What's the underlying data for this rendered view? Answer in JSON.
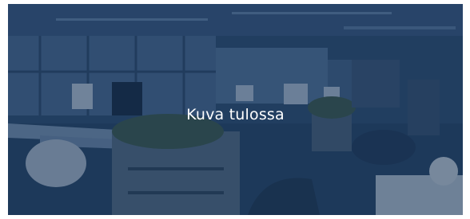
{
  "placeholder": {
    "caption": "Kuva tulossa",
    "overlay_color": "#1a3456"
  },
  "image": {
    "subject_icon": "office-photo-placeholder"
  }
}
